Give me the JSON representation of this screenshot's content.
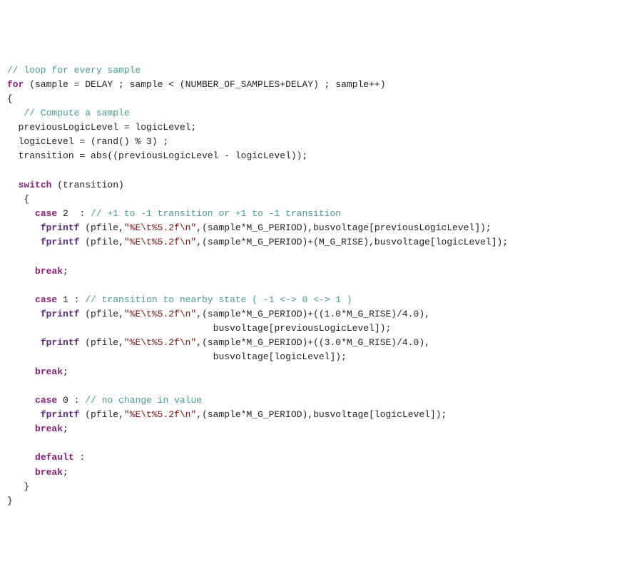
{
  "code": {
    "l1_c1": "// loop for every sample",
    "l2_kw_for": "for",
    "l2_p1": " (sample = DELAY ; sample < (NUMBER_OF_SAMPLES+DELAY) ; sample++)",
    "l3": "{",
    "l4_c1": "// Compute a sample",
    "l5": "  previousLogicLevel = logicLevel;",
    "l6": "  logicLevel = (rand() % 3) ;",
    "l7": "  transition = abs((previousLogicLevel - logicLevel));",
    "l8_kw_switch": "switch",
    "l8_p1": " (transition)",
    "l9": "   {",
    "l10_kw_case": "case",
    "l10_p1": " 2  : ",
    "l10_c1": "// +1 to -1 transition or +1 to -1 transition",
    "l11_fn": "fprintf",
    "l11_p1": " (pfile,",
    "l11_s1": "\"%E\\t%5.2f\\n\"",
    "l11_p2": ",(sample*M_G_PERIOD),busvoltage[previousLogicLevel]);",
    "l12_fn": "fprintf",
    "l12_p1": " (pfile,",
    "l12_s1": "\"%E\\t%5.2f\\n\"",
    "l12_p2": ",(sample*M_G_PERIOD)+(M_G_RISE),busvoltage[logicLevel]);",
    "l13_kw_break": "break",
    "l13_p1": ";",
    "l14_kw_case": "case",
    "l14_p1": " 1 : ",
    "l14_c1": "// transition to nearby state ( -1 <-> 0 <-> 1 )",
    "l15_fn": "fprintf",
    "l15_p1": " (pfile,",
    "l15_s1": "\"%E\\t%5.2f\\n\"",
    "l15_p2": ",(sample*M_G_PERIOD)+((1.0*M_G_RISE)/4.0),",
    "l15b": "                                     busvoltage[previousLogicLevel]);",
    "l16_fn": "fprintf",
    "l16_p1": " (pfile,",
    "l16_s1": "\"%E\\t%5.2f\\n\"",
    "l16_p2": ",(sample*M_G_PERIOD)+((3.0*M_G_RISE)/4.0),",
    "l16b": "                                     busvoltage[logicLevel]);",
    "l17_kw_break": "break",
    "l17_p1": ";",
    "l18_kw_case": "case",
    "l18_p1": " 0 : ",
    "l18_c1": "// no change in value",
    "l19_fn": "fprintf",
    "l19_p1": " (pfile,",
    "l19_s1": "\"%E\\t%5.2f\\n\"",
    "l19_p2": ",(sample*M_G_PERIOD),busvoltage[logicLevel]);",
    "l20_kw_break": "break",
    "l20_p1": ";",
    "l21_kw_default": "default",
    "l21_p1": " :",
    "l22_kw_break": "break",
    "l22_p1": ";",
    "l23": "   }",
    "l24": "}"
  }
}
